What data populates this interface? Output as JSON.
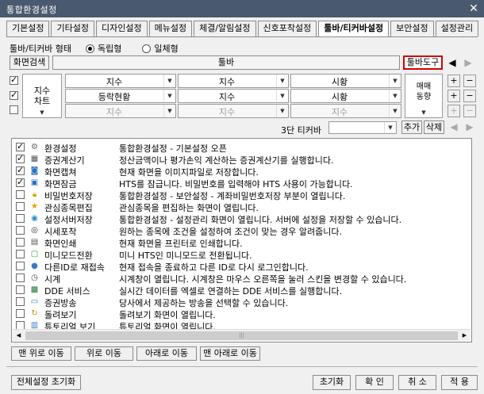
{
  "window": {
    "title": "통합환경설정"
  },
  "tabs": [
    "기본설정",
    "기타설정",
    "디자인설정",
    "메뉴설정",
    "체결/알림설정",
    "신호포착설정",
    "툴바/티커바설정",
    "보안설정",
    "설정관리"
  ],
  "active_tab": 6,
  "form": {
    "label": "툴바/티커바 형태",
    "option_independent": "독립형",
    "option_integrated": "일체형",
    "selected": "독립형"
  },
  "toolbar_row": {
    "screen_search": "화면검색",
    "toolbar_header": "툴바",
    "toolbar_tools": "툴바도구"
  },
  "ticker": {
    "vertical_select_left": "지수\n차트",
    "vertical_select_right": "매매\n동향",
    "grid": [
      [
        "지수",
        "지수",
        "시황"
      ],
      [
        "등락현황",
        "지수",
        "시황"
      ],
      [
        "지수",
        "지수",
        "지수"
      ]
    ],
    "row3_disabled": true,
    "ticker3_label": "3단 티커바",
    "add": "추가",
    "delete": "삭제"
  },
  "list_items": [
    {
      "name": "환경설정",
      "desc": "통합환경설정 - 기본설정 오픈",
      "checked": true,
      "icon": "gear-icon"
    },
    {
      "name": "증권계산기",
      "desc": "정산금액이나 평가손익 계산하는 증권계산기를 실행합니다.",
      "checked": true,
      "icon": "calculator-icon"
    },
    {
      "name": "화면캡쳐",
      "desc": "현재 화면을 이미지파일로 저장합니다.",
      "checked": true,
      "icon": "camera-icon"
    },
    {
      "name": "화면잠금",
      "desc": "HTS를 잠급니다. 비밀번호를 입력해야 HTS 사용이 가능합니다.",
      "checked": true,
      "icon": "screen-lock-icon"
    },
    {
      "name": "비밀번호저장",
      "desc": "통합환경설정 - 보안설정 - 계좌비밀번호저장 부분이 열립니다.",
      "checked": false,
      "icon": "padlock-icon"
    },
    {
      "name": "관심종목편집",
      "desc": "관심종목을 편집하는 화면이 열립니다.",
      "checked": false,
      "icon": "star-icon"
    },
    {
      "name": "설정서버저장",
      "desc": "통합환경설정 - 설정관리 화면이 열립니다. 서버에 설정을 저장할 수 있습니다.",
      "checked": false,
      "icon": "server-icon"
    },
    {
      "name": "시세포착",
      "desc": "원하는 종목에 조건을 설정하여 조건이 맞는 경우 알려줍니다.",
      "checked": false,
      "icon": "eye-icon"
    },
    {
      "name": "화면인쇄",
      "desc": "현재 화면을 프린터로 인쇄합니다.",
      "checked": false,
      "icon": "printer-icon"
    },
    {
      "name": "미니모드전환",
      "desc": "미니 HTS인 미니모드로 전환됩니다.",
      "checked": false,
      "icon": "minimize-icon"
    },
    {
      "name": "다른ID로 재접속",
      "desc": "현재 접속을 종료하고 다른 ID로 다시 로그인합니다.",
      "checked": false,
      "icon": "user-icon"
    },
    {
      "name": "시계",
      "desc": "시계창이 열립니다. 시계창은 마우스 오른쪽을 눌러 스킨을 변경할 수 있습니다.",
      "checked": false,
      "icon": "clock-icon"
    },
    {
      "name": "DDE 서비스",
      "desc": "실시간 데이터를 엑셀로 연결하는 DDE 서비스를 실행합니다.",
      "checked": false,
      "icon": "excel-icon"
    },
    {
      "name": "증권방송",
      "desc": "당사에서 제공하는 방송을 선택할 수 있습니다.",
      "checked": false,
      "icon": "tv-icon"
    },
    {
      "name": "돌려보기",
      "desc": "돌려보기 화면이 열립니다.",
      "checked": false,
      "icon": "rotate-icon"
    },
    {
      "name": "튜토리얼 보기",
      "desc": "튜토리얼 화면이 열립니다.",
      "checked": false,
      "icon": "tutorial-icon"
    }
  ],
  "move_buttons": [
    "맨 위로 이동",
    "위로 이동",
    "아래로 이동",
    "맨 아래로 이동"
  ],
  "footer": {
    "reset_all": "전체설정 초기화",
    "reset": "초기화",
    "ok": "확 인",
    "cancel": "취 소",
    "apply": "적 용"
  },
  "colors": {
    "titlebar": "#4a5a6e",
    "highlight_border": "#d40000"
  }
}
